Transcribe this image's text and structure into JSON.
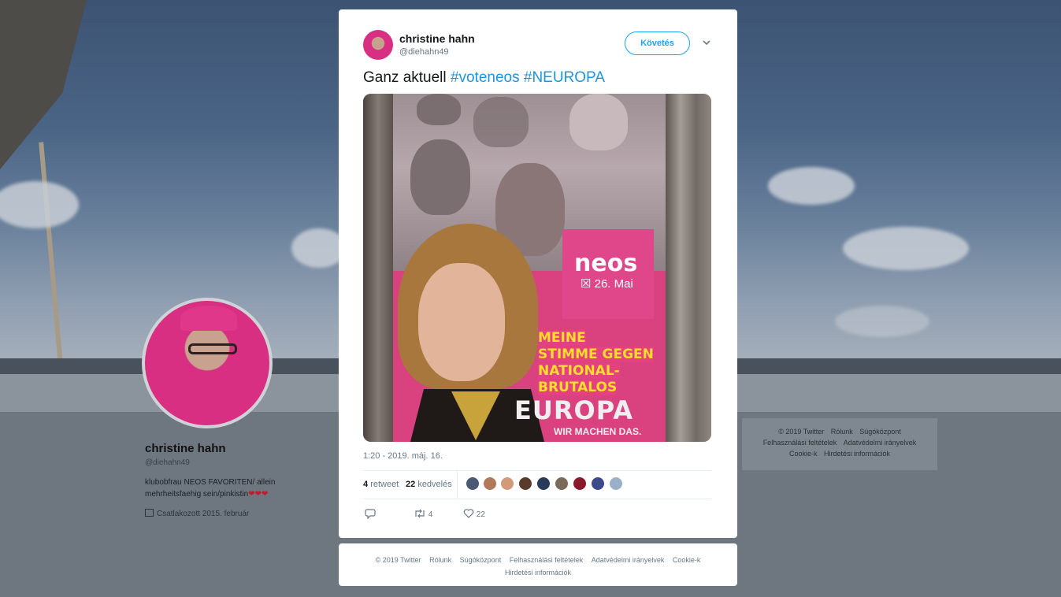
{
  "profile": {
    "name": "christine hahn",
    "handle": "@diehahn49",
    "bio": "klubobfrau NEOS FAVORITEN/ allein mehrheitsfaehig sein/pinkistin",
    "bio_hearts": "❤❤❤",
    "joined": "Csatlakozott 2015. február"
  },
  "right_footer": {
    "links": [
      "© 2019 Twitter",
      "Rólunk",
      "Súgóközpont",
      "Felhasználási feltételek",
      "Adatvédelmi irányelvek",
      "Cookie-k",
      "Hirdetési információk"
    ]
  },
  "tweet": {
    "author_name": "christine hahn",
    "author_handle": "@diehahn49",
    "follow_label": "Követés",
    "text_plain": "Ganz aktuell",
    "hashtag1": "#voteneos",
    "hashtag2": "#NEUROPA",
    "timestamp": "1:20 - 2019. máj. 16.",
    "retweet_count": "4",
    "retweet_label": "retweet",
    "like_count": "22",
    "like_label": "kedvelés",
    "action_retweets": "4",
    "action_likes": "22"
  },
  "poster": {
    "brand": "neos",
    "date": "☒ 26. Mai",
    "slogan_lines": [
      "MEINE",
      "STIMME GEGEN",
      "NATIONAL-",
      "BRUTALOS"
    ],
    "europa": "EUROPA",
    "sub": "WIR MACHEN DAS."
  },
  "liker_colors": [
    "#4a5a73",
    "#b07a5a",
    "#d39a7a",
    "#5a3a2a",
    "#2a3a5a",
    "#7a6a5a",
    "#8a1a2a",
    "#3a4a8a",
    "#9ab0c8"
  ],
  "modal_footer": {
    "links": [
      "© 2019 Twitter",
      "Rólunk",
      "Súgóközpont",
      "Felhasználási feltételek",
      "Adatvédelmi irányelvek",
      "Cookie-k",
      "Hirdetési információk"
    ]
  },
  "colors": {
    "accent": "#1da1f2",
    "hashtag": "#1b95e0",
    "neos_pink": "#e0468a"
  }
}
